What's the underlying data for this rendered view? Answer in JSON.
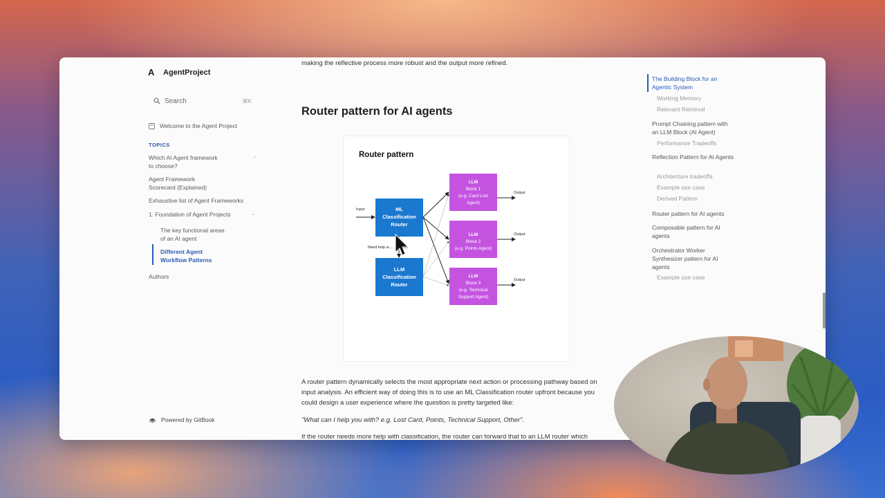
{
  "brand": {
    "logo": "A",
    "name": "AgentProject"
  },
  "search": {
    "placeholder": "Search",
    "shortcut": "⌘K"
  },
  "sidebar": {
    "welcome": "Welcome to the Agent Project",
    "topics_label": "TOPICS",
    "items": [
      {
        "label": "Which AI Agent framework to choose?"
      },
      {
        "label": "Agent Framework Scorecard (Explained)"
      },
      {
        "label": "Exhaustive list of Agent Frameworks"
      },
      {
        "label": "1. Foundation of Agent Projects"
      }
    ],
    "sub_items": [
      {
        "label": "The key functional areas of an AI agent"
      },
      {
        "label": "Different Agent Workflow Patterns"
      }
    ],
    "authors": "Authors",
    "powered_by": "Powered by GitBook"
  },
  "main": {
    "intro": "making the reflective process more robust and the output more refined.",
    "heading": "Router pattern for AI agents",
    "paragraph1": "A router pattern dynamically selects the most appropriate next action or processing pathway based on input analysis.  An efficient way of doing this is to use an ML Classification router upfront because you could design a user experience where the question is pretty targeted like:",
    "quote": "\"What can I help you with? e.g.  Lost Card, Points, Technical Support, Other\".",
    "paragraph2": "If the router needs more help with classification, the router can forward that to an LLM router which"
  },
  "diagram": {
    "title": "Router pattern",
    "input_label": "Input",
    "ml_router": [
      "ML",
      "Classification",
      "Router"
    ],
    "llm_router": [
      "LLM",
      "Classification",
      "Router"
    ],
    "need_help_label": "Need help w... ...fication",
    "blocks": [
      {
        "lines": [
          "LLM",
          "Block 1",
          "(e.g. Card Lost",
          "Agent)"
        ],
        "output": "Output"
      },
      {
        "lines": [
          "LLM",
          "Block 2",
          "(e.g. Points Agent)"
        ],
        "output": "Output"
      },
      {
        "lines": [
          "LLM",
          "Block 3",
          "(e.g. Technical",
          "Support Agent)"
        ],
        "output": "Output"
      }
    ],
    "colors": {
      "router": "#1a78cf",
      "block": "#c454e0"
    }
  },
  "toc": {
    "items": [
      {
        "label": "The Building Block for an Agentic System",
        "level": "main",
        "active": true
      },
      {
        "label": "Working Memory",
        "level": "sub"
      },
      {
        "label": "Relevant Retrieval",
        "level": "sub"
      },
      {
        "label": "Prompt Chaining pattern with an LLM Block (AI Agent)",
        "level": "main"
      },
      {
        "label": "Performance Tradeoffs",
        "level": "sub"
      },
      {
        "label": "Reflection Pattern for AI Agents",
        "level": "main"
      },
      {
        "label": "Architecture tradeoffs",
        "level": "sub"
      },
      {
        "label": "Example use case",
        "level": "sub"
      },
      {
        "label": "Derived Pattern",
        "level": "sub"
      },
      {
        "label": "Router pattern for AI agents",
        "level": "main"
      },
      {
        "label": "Composable pattern for AI agents",
        "level": "main"
      },
      {
        "label": "Orchestrator Worker Synthesizer pattern for AI agents",
        "level": "main"
      },
      {
        "label": "Example use case",
        "level": "sub"
      }
    ]
  },
  "icons": {
    "logo": "logo-icon",
    "search": "search-icon",
    "welcome": "page-icon",
    "chevron": "chevron-right-icon",
    "gitbook": "gitbook-icon",
    "cursor": "mouse-cursor-icon"
  }
}
